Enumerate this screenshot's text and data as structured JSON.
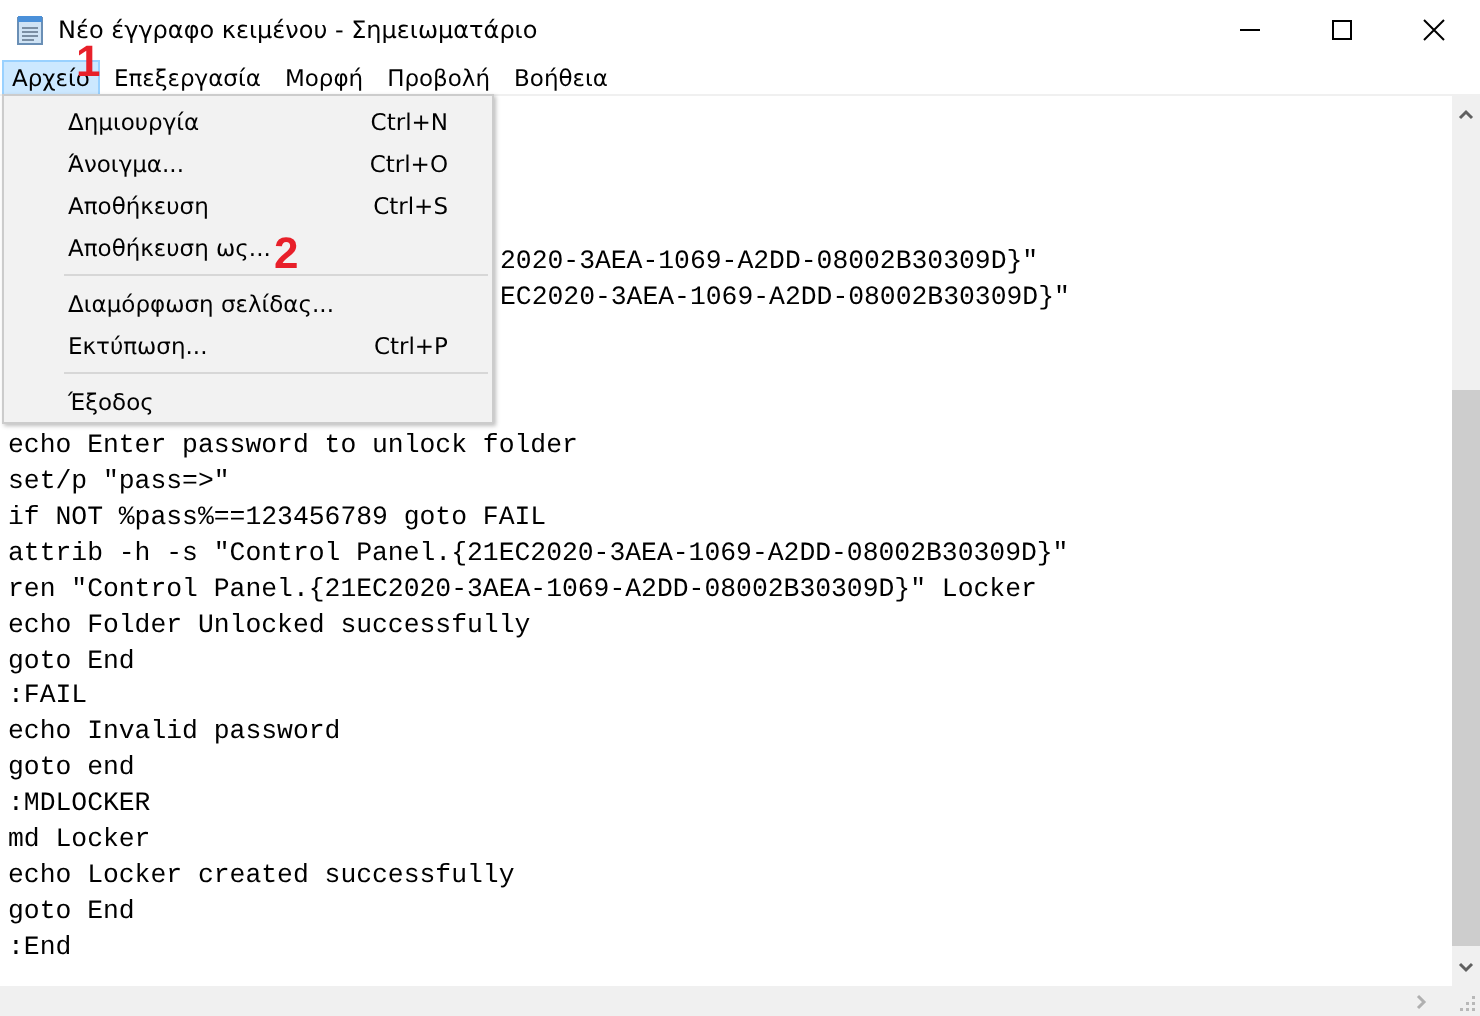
{
  "window": {
    "title": "Νέο έγγραφο κειμένου - Σημειωματάριο"
  },
  "menubar": [
    {
      "label": "Αρχείο",
      "selected": true
    },
    {
      "label": "Επεξεργασία",
      "selected": false
    },
    {
      "label": "Μορφή",
      "selected": false
    },
    {
      "label": "Προβολή",
      "selected": false
    },
    {
      "label": "Βοήθεια",
      "selected": false
    }
  ],
  "file_menu": [
    {
      "kind": "item",
      "label": "Δημιουργία",
      "shortcut": "Ctrl+N"
    },
    {
      "kind": "item",
      "label": "Άνοιγμα...",
      "shortcut": "Ctrl+O"
    },
    {
      "kind": "item",
      "label": "Αποθήκευση",
      "shortcut": "Ctrl+S"
    },
    {
      "kind": "item",
      "label": "Αποθήκευση ως..."
    },
    {
      "kind": "separator"
    },
    {
      "kind": "item",
      "label": "Διαμόρφωση σελίδας..."
    },
    {
      "kind": "item",
      "label": "Εκτύπωση...",
      "shortcut": "Ctrl+P"
    },
    {
      "kind": "separator"
    },
    {
      "kind": "item",
      "label": "Έξοδος"
    }
  ],
  "annotations": [
    "1",
    "2"
  ],
  "editor": {
    "partial_lines": [
      "2020-3AEA-1069-A2DD-08002B30309D}\"",
      "EC2020-3AEA-1069-A2DD-08002B30309D}\""
    ],
    "lines": [
      "echo Enter password to unlock folder",
      "set/p \"pass=>\"",
      "if NOT %pass%==123456789 goto FAIL",
      "attrib -h -s \"Control Panel.{21EC2020-3AEA-1069-A2DD-08002B30309D}\"",
      "ren \"Control Panel.{21EC2020-3AEA-1069-A2DD-08002B30309D}\" Locker",
      "echo Folder Unlocked successfully",
      "goto End",
      ":FAIL",
      "echo Invalid password",
      "goto end",
      ":MDLOCKER",
      "md Locker",
      "echo Locker created successfully",
      "goto End",
      ":End"
    ]
  }
}
